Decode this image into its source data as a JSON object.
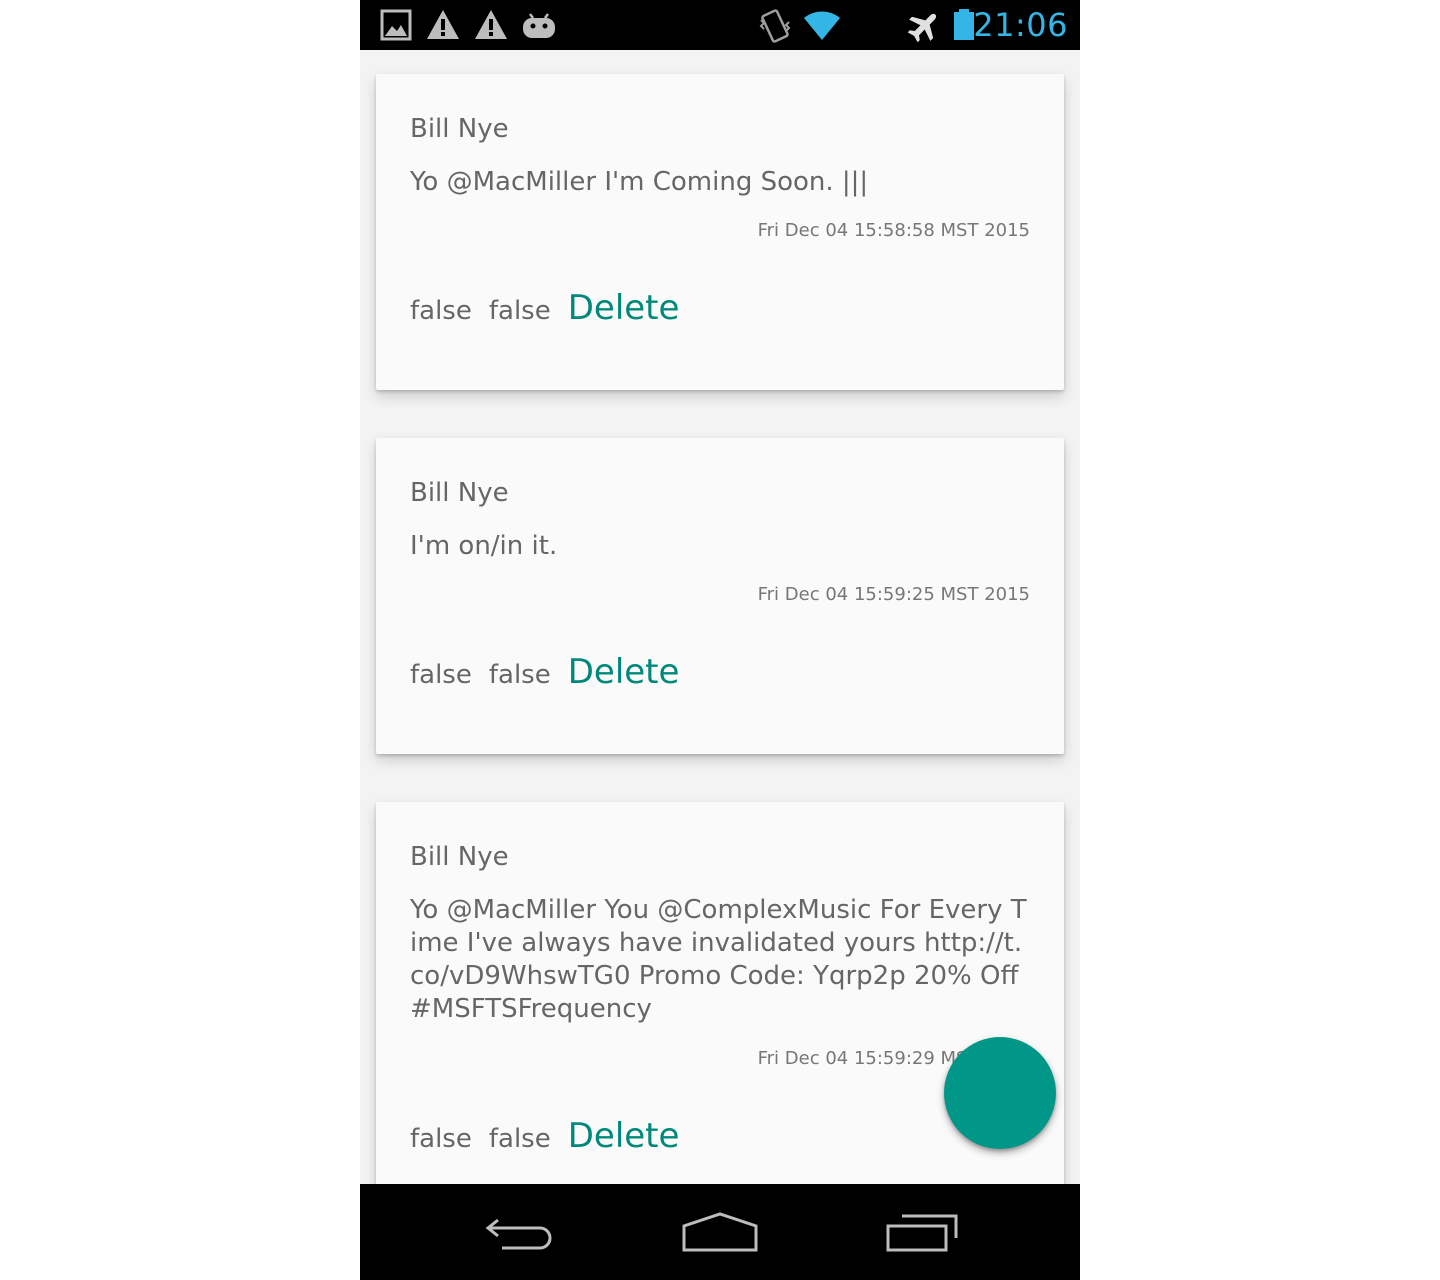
{
  "status_bar": {
    "time": "21:06",
    "left_icons": [
      "image-icon",
      "warning-icon",
      "warning-icon",
      "android-icon"
    ],
    "right_icons": [
      "vibrate-icon",
      "wifi-icon",
      "airplane-icon",
      "battery-icon"
    ],
    "accent_color": "#33b5e5"
  },
  "tweets": [
    {
      "author": "Bill Nye",
      "text": "Yo @MacMiller I'm Coming Soon. |||",
      "date": "Fri Dec 04 15:58:58 MST 2015",
      "flag1": "false",
      "flag2": "false",
      "delete_label": "Delete"
    },
    {
      "author": "Bill Nye",
      "text": "I'm on/in it.",
      "date": "Fri Dec 04 15:59:25 MST 2015",
      "flag1": "false",
      "flag2": "false",
      "delete_label": "Delete"
    },
    {
      "author": "Bill Nye",
      "text": "Yo @MacMiller You @ComplexMusic For Every Time I've always have invalidated yours http://t.co/vD9WhswTG0 Promo Code: Yqrp2p 20% Off #MSFTSFrequency",
      "date": "Fri Dec 04 15:59:29 MST 2015",
      "flag1": "false",
      "flag2": "false",
      "delete_label": "Delete"
    }
  ],
  "fab": {
    "color": "#009688"
  },
  "nav_bar": {
    "buttons": [
      "back-icon",
      "home-icon",
      "recents-icon"
    ]
  },
  "colors": {
    "delete_text": "#00897b",
    "card_bg": "#fafafa",
    "text": "#666666"
  }
}
